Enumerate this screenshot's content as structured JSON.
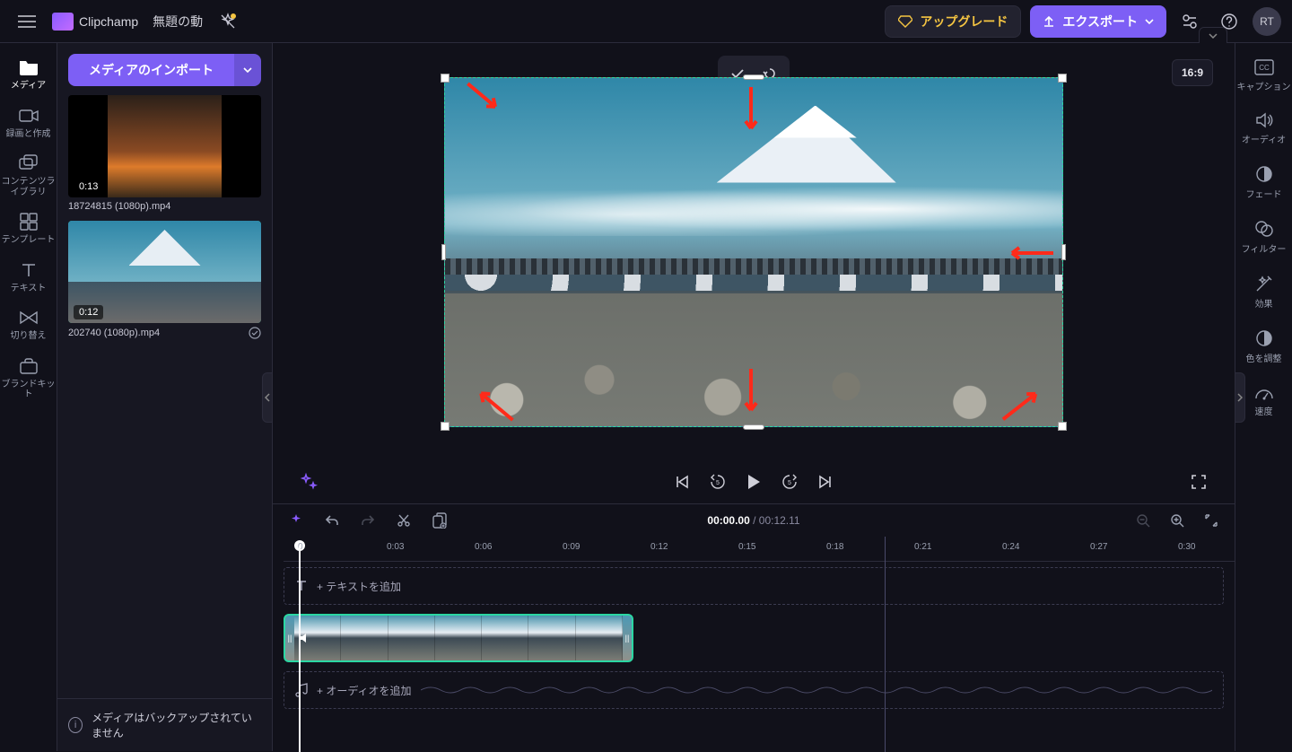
{
  "header": {
    "app_name": "Clipchamp",
    "project_title": "無題の動",
    "upgrade_label": "アップグレード",
    "export_label": "エクスポート",
    "avatar_initials": "RT"
  },
  "left_nav": {
    "items": [
      {
        "label": "メディア"
      },
      {
        "label": "録画と作成"
      },
      {
        "label": "コンテンツライブラリ"
      },
      {
        "label": "テンプレート"
      },
      {
        "label": "テキスト"
      },
      {
        "label": "切り替え"
      },
      {
        "label": "ブランドキット"
      }
    ]
  },
  "media_panel": {
    "import_label": "メディアのインポート",
    "clips": [
      {
        "duration": "0:13",
        "filename": "18724815 (1080p).mp4"
      },
      {
        "duration": "0:12",
        "filename": "202740 (1080p).mp4"
      }
    ],
    "backup_message": "メディアはバックアップされていません"
  },
  "preview": {
    "aspect_ratio": "16:9"
  },
  "timeline": {
    "current_time": "00:00.00",
    "total_time": "00:12.11",
    "separator": " / ",
    "ruler_start": "0",
    "ticks": [
      "0:03",
      "0:06",
      "0:09",
      "0:12",
      "0:15",
      "0:18",
      "0:21",
      "0:24",
      "0:27",
      "0:30"
    ],
    "text_placeholder": "+ テキストを追加",
    "audio_placeholder": "+ オーディオを追加"
  },
  "right_nav": {
    "items": [
      {
        "label": "キャプション"
      },
      {
        "label": "オーディオ"
      },
      {
        "label": "フェード"
      },
      {
        "label": "フィルター"
      },
      {
        "label": "効果"
      },
      {
        "label": "色を調整"
      },
      {
        "label": "速度"
      }
    ]
  }
}
